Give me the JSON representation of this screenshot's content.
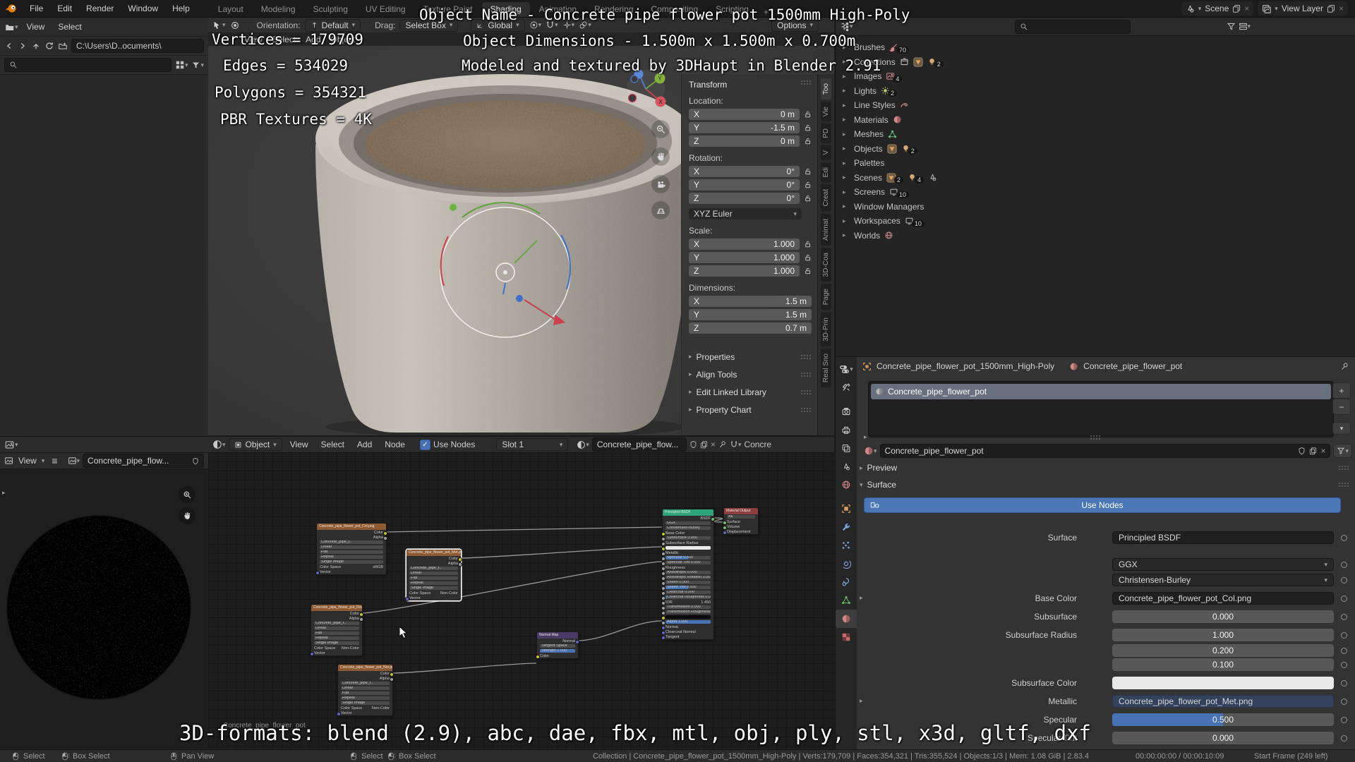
{
  "topbar": {
    "menus": [
      "File",
      "Edit",
      "Render",
      "Window",
      "Help"
    ],
    "tabs": [
      "Layout",
      "Modeling",
      "Sculpting",
      "UV Editing",
      "Texture Paint",
      "Shading",
      "Animation",
      "Rendering",
      "Compositing",
      "Scripting"
    ],
    "active_tab": "Shading",
    "plus": "+",
    "scene": {
      "label": "Scene"
    },
    "view_layer": {
      "label": "View Layer"
    }
  },
  "file_browser": {
    "menus": [
      "View",
      "Select"
    ],
    "path": "C:\\Users\\D..ocuments\\"
  },
  "viewport": {
    "orientation_label": "Orientation:",
    "orientation_value": "Default",
    "drag_label": "Drag:",
    "drag_value": "Select Box",
    "pivot_value": "Global",
    "options_label": "Options",
    "menus": [
      "View",
      "Select",
      "Add",
      "Object"
    ]
  },
  "npanel": {
    "title": "Transform",
    "tabs": [
      "Too",
      "Vie",
      "PD",
      "V",
      "Edi",
      "Creat",
      "Animat",
      "3D-Coa",
      "Page",
      "3D-Prin",
      "Real Sno"
    ],
    "groups": [
      {
        "label": "Location:",
        "locks": true,
        "rows": [
          [
            "X",
            "0 m"
          ],
          [
            "Y",
            "-1.5 m"
          ],
          [
            "Z",
            "0 m"
          ]
        ]
      },
      {
        "label": "Rotation:",
        "locks": true,
        "rows": [
          [
            "X",
            "0°"
          ],
          [
            "Y",
            "0°"
          ],
          [
            "Z",
            "0°"
          ]
        ],
        "after": "XYZ Euler"
      },
      {
        "label": "Scale:",
        "locks": true,
        "rows": [
          [
            "X",
            "1.000"
          ],
          [
            "Y",
            "1.000"
          ],
          [
            "Z",
            "1.000"
          ]
        ]
      },
      {
        "label": "Dimensions:",
        "locks": false,
        "rows": [
          [
            "X",
            "1.5 m"
          ],
          [
            "Y",
            "1.5 m"
          ],
          [
            "Z",
            "0.7 m"
          ]
        ]
      }
    ],
    "panels": [
      "Properties",
      "Align Tools",
      "Edit Linked Library",
      "Property Chart"
    ]
  },
  "outliner": {
    "items": [
      {
        "label": "Brushes",
        "badges": [
          {
            "icon": "brush",
            "count": "70"
          }
        ]
      },
      {
        "label": "Collections",
        "badges": [
          {
            "icon": "box"
          },
          {
            "icon": "tri"
          },
          {
            "icon": "bulb",
            "count": "2"
          }
        ]
      },
      {
        "label": "Images",
        "badges": [
          {
            "icon": "image",
            "count": "4"
          }
        ]
      },
      {
        "label": "Lights",
        "badges": [
          {
            "icon": "light",
            "count": "2"
          }
        ]
      },
      {
        "label": "Line Styles",
        "badges": [
          {
            "icon": "linestyle"
          }
        ]
      },
      {
        "label": "Materials",
        "badges": [
          {
            "icon": "material"
          }
        ]
      },
      {
        "label": "Meshes",
        "badges": [
          {
            "icon": "meshdata"
          }
        ]
      },
      {
        "label": "Objects",
        "badges": [
          {
            "icon": "tri"
          },
          {
            "icon": "bulb",
            "count": "2"
          }
        ]
      },
      {
        "label": "Palettes",
        "badges": []
      },
      {
        "label": "Scenes",
        "badges": [
          {
            "icon": "tri",
            "count": "2"
          },
          {
            "icon": "bulb",
            "count": "4"
          },
          {
            "icon": "scene"
          }
        ]
      },
      {
        "label": "Screens",
        "badges": [
          {
            "icon": "screen",
            "count": "10"
          }
        ]
      },
      {
        "label": "Window Managers",
        "badges": []
      },
      {
        "label": "Workspaces",
        "badges": [
          {
            "icon": "screen",
            "count": "10"
          }
        ]
      },
      {
        "label": "Worlds",
        "badges": [
          {
            "icon": "world"
          }
        ]
      }
    ]
  },
  "properties": {
    "breadcrumb": {
      "object": "Concrete_pipe_flower_pot_1500mm_High-Poly",
      "material": "Concrete_pipe_flower_pot"
    },
    "slot_name": "Concrete_pipe_flower_pot",
    "material_name": "Concrete_pipe_flower_pot",
    "preview_label": "Preview",
    "surface_label": "Surface",
    "use_nodes": "Use Nodes",
    "rows": [
      {
        "label": "Surface",
        "value": "Principled BSDF",
        "kind": "field"
      },
      {
        "label": "",
        "value": "GGX",
        "kind": "dropdown"
      },
      {
        "label": "",
        "value": "Christensen-Burley",
        "kind": "dropdown"
      },
      {
        "label": "Base Color",
        "value": "Concrete_pipe_flower_pot_Col.png",
        "kind": "field",
        "expand": true
      },
      {
        "label": "Subsurface",
        "value": "0.000",
        "kind": "slider",
        "fill": 0
      },
      {
        "label": "Subsurface Radius",
        "value": "1.000",
        "kind": "slider",
        "fill": 0
      },
      {
        "label": "",
        "value": "0.200",
        "kind": "slider",
        "fill": 0
      },
      {
        "label": "",
        "value": "0.100",
        "kind": "slider",
        "fill": 0
      },
      {
        "label": "Subsurface Color",
        "value": "",
        "kind": "color",
        "color": "#e8e8e8"
      },
      {
        "label": "Metallic",
        "value": "Concrete_pipe_flower_pot_Met.png",
        "kind": "fieldblue",
        "expand": true
      },
      {
        "label": "Specular",
        "value": "0.500",
        "kind": "slider",
        "fill": 50
      },
      {
        "label": "Specular Tint",
        "value": "0.000",
        "kind": "slider",
        "fill": 0
      }
    ]
  },
  "image_editor": {
    "view_menu": "View",
    "image_name": "Concrete_pipe_flow..."
  },
  "shader_editor": {
    "header": {
      "object": "Object",
      "menus": [
        "View",
        "Select",
        "Add",
        "Node"
      ],
      "use_nodes": "Use Nodes",
      "slot": "Slot 1",
      "material": "Concrete_pipe_flow...",
      "trailing": "Concre"
    },
    "watermark": "Concrete_pipe_flower_pot",
    "image_nodes": [
      {
        "title": "Concrete_pipe_flower_pot_Col.png",
        "colorspace": "sRGB",
        "selected": false
      },
      {
        "title": "Concrete_pipe_flower_pot_Met.png",
        "colorspace": "Non-Color",
        "selected": true
      },
      {
        "title": "Concrete_pipe_flower_pot_Rough.png",
        "colorspace": "Non-Color",
        "selected": false
      },
      {
        "title": "Concrete_pipe_flower_pot_Nor.png",
        "colorspace": "Non-Color",
        "selected": false
      }
    ],
    "image_node_rows": [
      "Linear",
      "Flat",
      "Repeat",
      "Single Image"
    ],
    "image_node_common": {
      "name_short": "Concrete_pipe_f..",
      "cs_label": "Color Space",
      "outputs": [
        "Color",
        "Alpha"
      ],
      "input": "Vector"
    },
    "normal_map": {
      "title": "Normal Map",
      "output": "Normal",
      "rows": [
        "Tangent Space",
        "Strength  1.000",
        "Color"
      ]
    },
    "bsdf": {
      "title": "Principled BSDF",
      "output": "BSDF",
      "rows": [
        {
          "k": "dd",
          "l": "GGX"
        },
        {
          "k": "dd",
          "l": "Christensen-Burley"
        },
        {
          "k": "sock",
          "l": "Base Color"
        },
        {
          "k": "slider",
          "l": "Subsurface",
          "v": "0.000",
          "f": 0
        },
        {
          "k": "sock",
          "l": "Subsurface Radius"
        },
        {
          "k": "color",
          "l": "Subsurface Color",
          "c": "#e8e8e8"
        },
        {
          "k": "sock",
          "l": "Metallic"
        },
        {
          "k": "slider",
          "l": "Specular",
          "v": "0.500",
          "f": 50
        },
        {
          "k": "slider",
          "l": "Specular Tint",
          "v": "0.000",
          "f": 0
        },
        {
          "k": "sock",
          "l": "Roughness"
        },
        {
          "k": "slider",
          "l": "Anisotropic",
          "v": "0.000",
          "f": 0
        },
        {
          "k": "slider",
          "l": "Anisotropic Rotation",
          "v": "0.000",
          "f": 0
        },
        {
          "k": "slider",
          "l": "Sheen",
          "v": "0.000",
          "f": 0
        },
        {
          "k": "slider",
          "l": "Sheen Tint",
          "v": "0.500",
          "f": 50
        },
        {
          "k": "slider",
          "l": "Clearcoat",
          "v": "0.000",
          "f": 0
        },
        {
          "k": "slider",
          "l": "Clearcoat Roughness",
          "v": "0.030",
          "f": 3
        },
        {
          "k": "val",
          "l": "IOR",
          "v": "1.450"
        },
        {
          "k": "slider",
          "l": "Transmission",
          "v": "0.000",
          "f": 0
        },
        {
          "k": "slider",
          "l": "Transmission Roughness",
          "v": "0.000",
          "f": 0
        },
        {
          "k": "color",
          "l": "Emission",
          "c": "#0a0a0a"
        },
        {
          "k": "slider",
          "l": "Alpha",
          "v": "1.000",
          "f": 100
        },
        {
          "k": "sock",
          "l": "Normal"
        },
        {
          "k": "sock",
          "l": "Clearcoat Normal"
        },
        {
          "k": "sock",
          "l": "Tangent"
        }
      ]
    },
    "output_node": {
      "title": "Material Output",
      "rows": [
        "All",
        "Surface",
        "Volume",
        "Displacement"
      ]
    }
  },
  "status_bar": {
    "left": [
      {
        "icon": "lmb",
        "label": "Select"
      },
      {
        "icon": "lmbd",
        "label": "Box Select"
      },
      {
        "icon": "mmb",
        "label": "Pan View"
      },
      {
        "icon": "lmb",
        "label": "Select"
      },
      {
        "icon": "lmbd",
        "label": "Box Select"
      }
    ],
    "stats": "Collection | Concrete_pipe_flower_pot_1500mm_High-Poly | Verts:179,709 | Faces:354,321 | Tris:355,524 | Objects:1/3 | Mem: 1.08 GiB | 2.83.4",
    "time": "00:00:00:00 / 00:00:10:09",
    "frames": "Start Frame (249 left)"
  },
  "overlays": {
    "object_name": "Object Name - Concrete pipe flower pot 1500mm High-Poly",
    "dimensions": "Object Dimensions - 1.500m x 1.500m x 0.700m",
    "credit": "Modeled and textured by 3DHaupt in Blender 2.91",
    "stats": [
      "Vertices = 179709",
      "Edges = 534029",
      "Polygons = 354321",
      "PBR Textures = 4K"
    ],
    "formats": "3D-formats: blend (2.9), abc, dae, fbx, mtl, obj, ply, stl, x3d, gltf, dxf"
  },
  "colors": {
    "accent": "#4772b3",
    "node_image_header": "#8d5a33",
    "node_bsdf_header": "#2da37a",
    "node_output_header": "#8d3f3f",
    "selected_slot": "#687080"
  }
}
